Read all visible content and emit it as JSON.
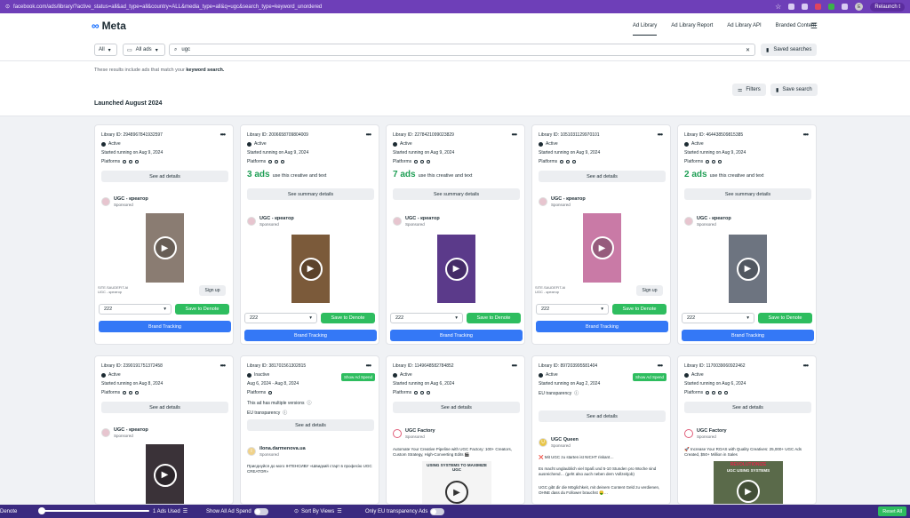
{
  "browser": {
    "url": "facebook.com/ads/library/?active_status=all&ad_type=all&country=ALL&media_type=all&q=ugc&search_type=keyword_unordered",
    "profile_initial": "E",
    "relaunch_label": "Relaunch t"
  },
  "topnav": {
    "logo_text": "Meta",
    "links": [
      "Ad Library",
      "Ad Library Report",
      "Ad Library API",
      "Branded Content"
    ]
  },
  "search": {
    "country": "All",
    "ad_type": "All ads",
    "query": "ugc",
    "saved_label": "Saved searches"
  },
  "info": {
    "text_before": "These results include ads that match your",
    "text_bold": "keyword search.",
    "filters_label": "Filters",
    "save_search_label": "Save search",
    "launched_heading": "Launched August 2024"
  },
  "cards": [
    {
      "id": "Library ID: 2948967841932597",
      "status": "Active",
      "started": "Started running on Aug 9, 2024",
      "platforms": "Platforms",
      "details": "See ad details",
      "advertiser": "UGC - креатор",
      "sponsored": "Sponsored",
      "caption1": "SITE.SAUDEFIT.AI",
      "caption2": "UGC - креатор",
      "signup": "Sign up",
      "dropdown": "222",
      "save": "Save to Denote",
      "brand": "Brand Tracking"
    },
    {
      "id": "Library ID: 2006658709804009",
      "status": "Active",
      "started": "Started running on Aug 9, 2024",
      "platforms": "Platforms",
      "count": "3 ads",
      "count_text": "use this creative and text",
      "details": "See summary details",
      "advertiser": "UGC - креатор",
      "sponsored": "Sponsored",
      "dropdown": "222",
      "save": "Save to Denote",
      "brand": "Brand Tracking"
    },
    {
      "id": "Library ID: 2278421099023829",
      "status": "Active",
      "started": "Started running on Aug 9, 2024",
      "platforms": "Platforms",
      "count": "7 ads",
      "count_text": "use this creative and text",
      "details": "See summary details",
      "advertiser": "UGC - креатор",
      "sponsored": "Sponsored",
      "dropdown": "222",
      "save": "Save to Denote",
      "brand": "Brand Tracking"
    },
    {
      "id": "Library ID: 1051031129970101",
      "status": "Active",
      "started": "Started running on Aug 9, 2024",
      "platforms": "Platforms",
      "details": "See ad details",
      "advertiser": "UGC - креатор",
      "sponsored": "Sponsored",
      "caption1": "SITE.SAUDEFIT.AI",
      "caption2": "UGC - креатор",
      "signup": "Sign up",
      "dropdown": "222",
      "save": "Save to Denote",
      "brand": "Brand Tracking"
    },
    {
      "id": "Library ID: 464438509815385",
      "status": "Active",
      "started": "Started running on Aug 9, 2024",
      "platforms": "Platforms",
      "count": "2 ads",
      "count_text": "use this creative and text",
      "details": "See summary details",
      "advertiser": "UGC - креатор",
      "sponsored": "Sponsored",
      "dropdown": "222",
      "save": "Save to Denote",
      "brand": "Brand Tracking"
    },
    {
      "id": "Library ID: 2390191751372458",
      "status": "Active",
      "started": "Started running on Aug 8, 2024",
      "platforms": "Platforms",
      "details": "See ad details",
      "advertiser": "UGC - креатор",
      "sponsored": "Sponsored"
    },
    {
      "id": "Library ID: 381701561302815",
      "status": "Inactive",
      "show_spend": "Show Ad Spend",
      "started": "Aug 6, 2024 - Aug 8, 2024",
      "platforms": "Platforms",
      "versions": "This ad has multiple versions",
      "eu": "EU transparency",
      "details": "See ad details",
      "advertiser": "ilona.darmenova.ua",
      "sponsored": "Sponsored",
      "body": "Приєднуйся до мого ІНТЕНСИВУ «Швидкий старт в професію UGC CREATOR»"
    },
    {
      "id": "Library ID: 1149648582784852",
      "status": "Active",
      "started": "Started running on Aug 6, 2024",
      "platforms": "Platforms",
      "details": "See ad details",
      "advertiser": "UGC Factory",
      "sponsored": "Sponsored",
      "body": "Automate Your Creative Pipeline with UGC Factory: 100+ Creators, Custom Strategy, High-Converting Edits 🎬",
      "banner": "USING SYSTEMS TO MAXIMIZE UGC"
    },
    {
      "id": "Library ID: 897203995581404",
      "status": "Active",
      "show_spend": "Show Ad Spend",
      "started": "Started running on Aug 2, 2024",
      "eu": "EU transparency",
      "details": "See ad details",
      "advertiser": "UGC Queen",
      "sponsored": "Sponsored",
      "body1": "❌ Mit UGC zu starten ist NICHT riskant…",
      "body2": "Es macht unglaublich viel Spaß und 5-10 Stunden pro Woche sind ausreichend… (geht also auch neben dem Vollzeitjob)",
      "body3": "UGC gibt dir die Möglichkeit, mit deinem Content Geld zu verdienen, OHNE dass du Follower brauchst 🤑…"
    },
    {
      "id": "Library ID: 1170039060922462",
      "status": "Active",
      "started": "Started running on Aug 6, 2024",
      "platforms": "Platforms",
      "details": "See ad details",
      "advertiser": "UGC Factory",
      "sponsored": "Sponsored",
      "body": "🚀 Increase Your ROAS with Quality Creatives: 25,000+ UGC Ads Created, $50+ Million in Sales",
      "banner1": "REVOLUTIONIZE",
      "banner2": "UGC USING SYSTEMS"
    }
  ],
  "bottom": {
    "left_label": "Denote",
    "ads_used": "1 Ads Used",
    "show_all_spend": "Show All Ad Spend",
    "sort_by_views": "Sort By Views",
    "eu_only": "Only EU transparency Ads",
    "reset": "Reset All"
  },
  "colors": {
    "browser_bar": "#6e3fb8",
    "green": "#2ebd5f",
    "blue": "#3478f6",
    "bottom_bar": "#3b2a80"
  }
}
